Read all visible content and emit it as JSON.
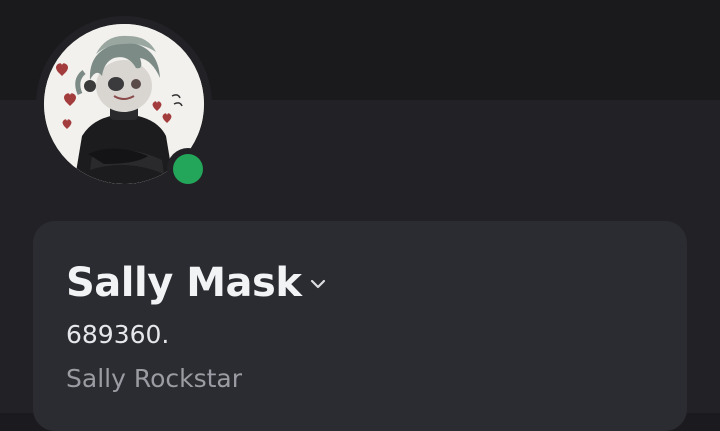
{
  "profile": {
    "display_name": "Sally Mask",
    "username": "689360.",
    "pronouns": "Sally Rockstar",
    "status": "online",
    "status_color": "#23a55a"
  },
  "theme": {
    "background": "#222226",
    "banner": "#1a1a1c",
    "card": "#2b2c31",
    "text_primary": "#f2f3f5",
    "text_muted": "#9b9ca3"
  },
  "icons": {
    "expand": "chevron-down-icon"
  }
}
